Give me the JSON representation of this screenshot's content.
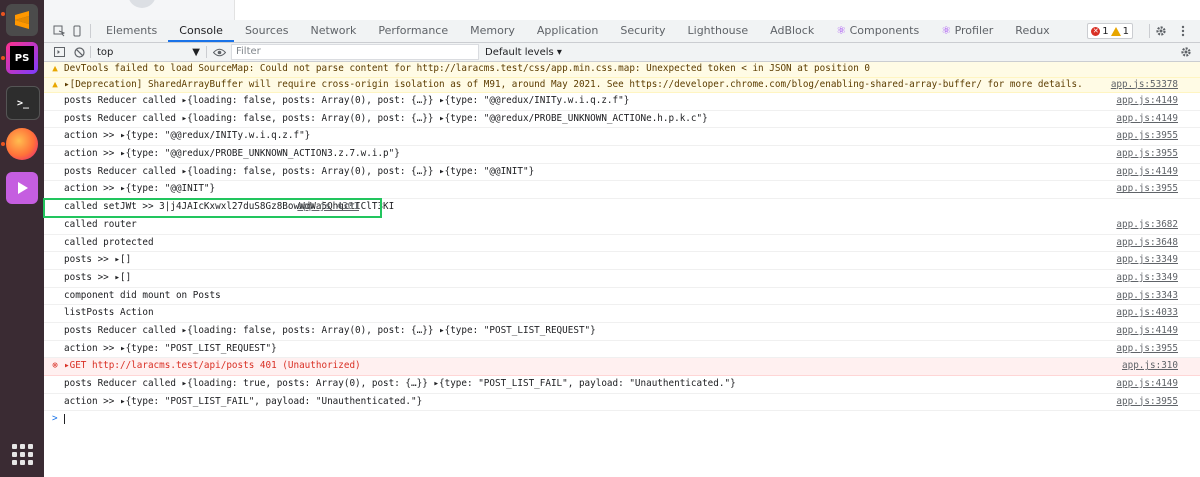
{
  "devtools": {
    "tabs": [
      "Elements",
      "Console",
      "Sources",
      "Network",
      "Performance",
      "Memory",
      "Application",
      "Security",
      "Lighthouse",
      "AdBlock",
      "Components",
      "Profiler",
      "Redux"
    ],
    "active_tab": "Console",
    "error_count": "1",
    "warning_count": "1"
  },
  "toolbar": {
    "context": "top",
    "filter_placeholder": "Filter",
    "levels": "Default levels ▾"
  },
  "console": {
    "lines": [
      {
        "type": "warn",
        "text": "DevTools failed to load SourceMap: Could not parse content for http://laracms.test/css/app.min.css.map: Unexpected token < in JSON at position 0",
        "source": ""
      },
      {
        "type": "warn",
        "text": "▸[Deprecation] SharedArrayBuffer will require cross-origin isolation as of M91, around May 2021. See https://developer.chrome.com/blog/enabling-shared-array-buffer/ for more details.",
        "source": "app.js:53378"
      },
      {
        "type": "log",
        "text": "posts Reducer called ▸{loading: false, posts: Array(0), post: {…}} ▸{type: \"@@redux/INITy.w.i.q.z.f\"}",
        "source": "app.js:4149"
      },
      {
        "type": "log",
        "text": "posts Reducer called ▸{loading: false, posts: Array(0), post: {…}} ▸{type: \"@@redux/PROBE_UNKNOWN_ACTIONe.h.p.k.c\"}",
        "source": "app.js:4149"
      },
      {
        "type": "log",
        "text": "action >> ▸{type: \"@@redux/INITy.w.i.q.z.f\"}",
        "source": "app.js:3955"
      },
      {
        "type": "log",
        "text": "action >> ▸{type: \"@@redux/PROBE_UNKNOWN_ACTION3.z.7.w.i.p\"}",
        "source": "app.js:3955"
      },
      {
        "type": "log",
        "text": "posts Reducer called ▸{loading: false, posts: Array(0), post: {…}} ▸{type: \"@@INIT\"}",
        "source": "app.js:4149"
      },
      {
        "type": "log",
        "text": "action >> ▸{type: \"@@INIT\"}",
        "source": "app.js:3955"
      },
      {
        "type": "log",
        "highlight": true,
        "text": "called setJWt >> 3|j4JAIcKxwxl27duS8Gz8BowWdWa5QhgctIClT3KI",
        "source": "app.js:4301"
      },
      {
        "type": "log",
        "text": "called router",
        "source": "app.js:3682"
      },
      {
        "type": "log",
        "text": "called protected",
        "source": "app.js:3648"
      },
      {
        "type": "log",
        "text": "posts >>  ▸[]",
        "source": "app.js:3349"
      },
      {
        "type": "log",
        "text": "posts >>  ▸[]",
        "source": "app.js:3349"
      },
      {
        "type": "log",
        "text": "component did mount on Posts",
        "source": "app.js:3343"
      },
      {
        "type": "log",
        "text": "listPosts Action",
        "source": "app.js:4033"
      },
      {
        "type": "log",
        "text": "posts Reducer called ▸{loading: false, posts: Array(0), post: {…}} ▸{type: \"POST_LIST_REQUEST\"}",
        "source": "app.js:4149"
      },
      {
        "type": "log",
        "text": "action >> ▸{type: \"POST_LIST_REQUEST\"}",
        "source": "app.js:3955"
      },
      {
        "type": "error",
        "text": "▸GET http://laracms.test/api/posts 401 (Unauthorized)",
        "source": "app.js:310"
      },
      {
        "type": "log",
        "text": "posts Reducer called ▸{loading: true, posts: Array(0), post: {…}} ▸{type: \"POST_LIST_FAIL\", payload: \"Unauthenticated.\"}",
        "source": "app.js:4149"
      },
      {
        "type": "log",
        "text": "action >> ▸{type: \"POST_LIST_FAIL\", payload: \"Unauthenticated.\"}",
        "source": "app.js:3955"
      }
    ],
    "prompt": ">"
  }
}
